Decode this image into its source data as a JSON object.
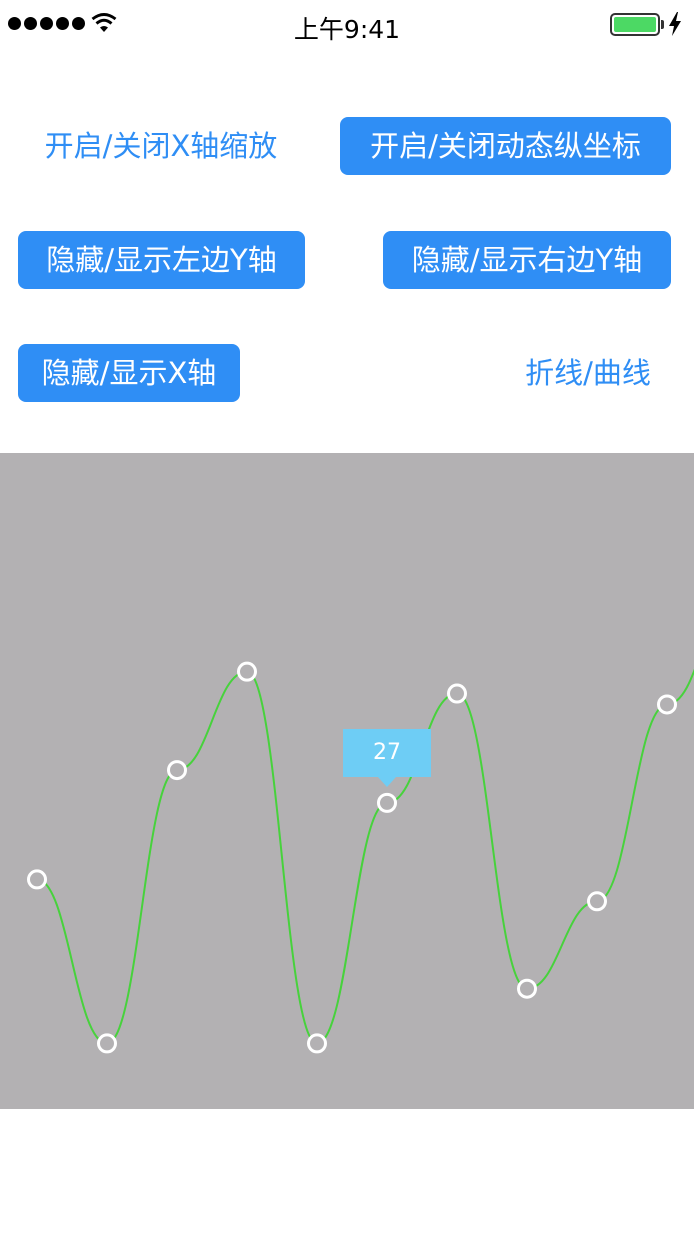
{
  "status_bar": {
    "time": "上午9:41",
    "battery_color": "#4cd964"
  },
  "buttons": {
    "toggle_x_zoom": "开启/关闭X轴缩放",
    "toggle_dynamic_axis": "开启/关闭动态纵坐标",
    "toggle_left_y": "隐藏/显示左边Y轴",
    "toggle_right_y": "隐藏/显示右边Y轴",
    "toggle_x_axis": "隐藏/显示X轴",
    "line_curve": "折线/曲线"
  },
  "colors": {
    "button_fill": "#2f8ef5",
    "chart_background": "#b3b1b3",
    "line": "#47d23c",
    "tooltip": "#6ecdf5"
  },
  "chart_data": {
    "type": "line",
    "curve": "smooth",
    "series": [
      {
        "values": [
          21,
          6,
          31,
          40,
          6,
          28,
          38,
          11,
          19,
          37
        ]
      }
    ],
    "highlight_index": 5,
    "tooltip_value": "27",
    "ylim": [
      0,
      60
    ],
    "grid": false,
    "x_axis_visible": false,
    "y_axis_visible": false
  }
}
